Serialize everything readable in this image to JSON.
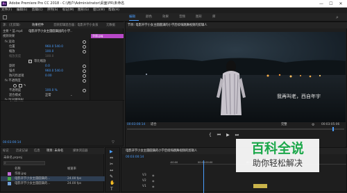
{
  "titlebar": {
    "app_icon": "Pr",
    "title": "Adobe Premiere Pro CC 2018 - C:\\用户\\Administrator\\桌面\\PR\\未命名",
    "minimize": "—",
    "maximize": "☐",
    "close": "✕"
  },
  "menu": [
    "文件(F)",
    "编辑(E)",
    "剪辑(C)",
    "序列(S)",
    "标记(M)",
    "图形(G)",
    "窗口(W)",
    "帮助(H)"
  ],
  "workspaces": [
    "编辑",
    "颜色",
    "效果",
    "音频",
    "图形",
    "库"
  ],
  "active_workspace": "编辑",
  "effect_controls": {
    "tabs": [
      "源：(无剪辑)",
      "效果控件",
      "音频剪辑混合器：电影开学小女孩",
      "元数据"
    ],
    "breadcrumb": "主要 * 蓝.mp4",
    "clip": "电影开学小女主圆圆满园的小学..",
    "track_clip": "华丽.jpg",
    "section": "视频效果",
    "rows": [
      {
        "label": "fx  运动"
      },
      {
        "label": "位置",
        "value": "960.0  540.0"
      },
      {
        "label": "缩放",
        "value": "100.0"
      },
      {
        "label": "缩放宽度",
        "value": "100.0"
      },
      {
        "label": "",
        "value": "等比缩放"
      },
      {
        "label": "旋转",
        "value": "0.0"
      },
      {
        "label": "锚点",
        "value": "960.0  540.0"
      },
      {
        "label": "防闪烁滤镜",
        "value": "0.00"
      },
      {
        "label": "fx  不透明度"
      },
      {
        "label": "不透明度",
        "value": "100.0 %"
      },
      {
        "label": "混合模式",
        "value": "正常"
      },
      {
        "label": "fx  时间重映射"
      }
    ],
    "timecode": "00:03:00:14"
  },
  "program": {
    "tab": "节目: 电影开学小女主圆圆满的小学后续嗨跳舞视频的剪辑人",
    "subtitle": "我再叫老，西自年宇",
    "timecode": "00:03:00:14",
    "fit": "适合",
    "quality": "完整",
    "duration": "00:03:05:06"
  },
  "project": {
    "tabs": [
      "标记",
      "历史记录",
      "信息",
      "项目: 未命名",
      "媒体浏览器"
    ],
    "name": "未命名.prproj",
    "search_placeholder": "",
    "col_name": "名称",
    "col_rate": "帧速率",
    "items": [
      {
        "name": "华丽.jpg",
        "rate": ""
      },
      {
        "name": "电影开学小女主圆圆满的...",
        "rate": "24.00 fps"
      },
      {
        "name": "电影开学小女主圆圆满的...",
        "rate": "24.00 fps"
      }
    ]
  },
  "tools": [
    "▶",
    "⇔",
    "✂",
    "↔",
    "✎",
    "✋",
    "T"
  ],
  "timeline": {
    "tab": "电影开学小女主圆圆满的小学后续嗨跳舞视频的剪辑人",
    "timecode": "00:03:00:14",
    "ruler": [
      ":00:00",
      "00:05:00:00",
      "00:10:00:00"
    ],
    "tracks": [
      "V3",
      "V2",
      "V1"
    ]
  },
  "watermark": {
    "title": "百科全说",
    "subtitle": "助你轻松解决",
    "color": "#1ba84a"
  },
  "colors": {
    "accent": "#4a9eff",
    "playhead": "#e04ee0"
  }
}
